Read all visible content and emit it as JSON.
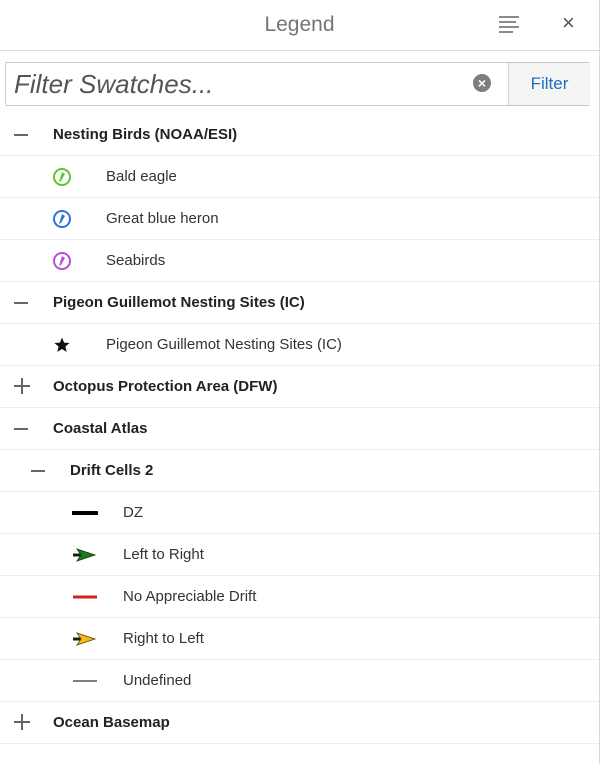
{
  "panel": {
    "title": "Legend",
    "menu_icon": "list-icon",
    "close_icon": "close-icon",
    "close_glyph": "×"
  },
  "filter": {
    "placeholder": "Filter Swatches...",
    "value": "",
    "clear_icon": "clear-x-icon",
    "clear_glyph": "×",
    "button_label": "Filter"
  },
  "colors": {
    "accent": "#1f6fc1",
    "bald_eagle": "#5cc82e",
    "heron": "#2f74d8",
    "seabirds": "#b64fd3",
    "dz": "#000000",
    "left_to_right_arrow": "#1b7a1b",
    "no_drift": "#d62020",
    "right_to_left_arrow": "#f3b81a",
    "undefined": "#808080"
  },
  "legend": {
    "nesting_birds": {
      "title": "Nesting Birds (NOAA/ESI)",
      "expanded": true,
      "items": [
        {
          "label": "Bald eagle",
          "icon": "bird-marker-green-icon"
        },
        {
          "label": "Great blue heron",
          "icon": "bird-marker-blue-icon"
        },
        {
          "label": "Seabirds",
          "icon": "bird-marker-purple-icon"
        }
      ]
    },
    "pigeon": {
      "title": "Pigeon Guillemot Nesting Sites (IC)",
      "expanded": true,
      "items": [
        {
          "label": "Pigeon Guillemot Nesting Sites (IC)",
          "icon": "star-icon"
        }
      ]
    },
    "octopus": {
      "title": "Octopus Protection Area (DFW)",
      "expanded": false
    },
    "coastal_atlas": {
      "title": "Coastal Atlas",
      "expanded": true,
      "drift_cells": {
        "title": "Drift Cells 2",
        "expanded": true,
        "items": [
          {
            "label": "DZ",
            "icon": "black-line-icon"
          },
          {
            "label": "Left to Right",
            "icon": "green-arrow-icon"
          },
          {
            "label": "No Appreciable Drift",
            "icon": "red-line-icon"
          },
          {
            "label": "Right to Left",
            "icon": "yellow-arrow-icon"
          },
          {
            "label": "Undefined",
            "icon": "gray-line-icon"
          }
        ]
      }
    },
    "ocean_basemap": {
      "title": "Ocean Basemap",
      "expanded": false
    }
  }
}
